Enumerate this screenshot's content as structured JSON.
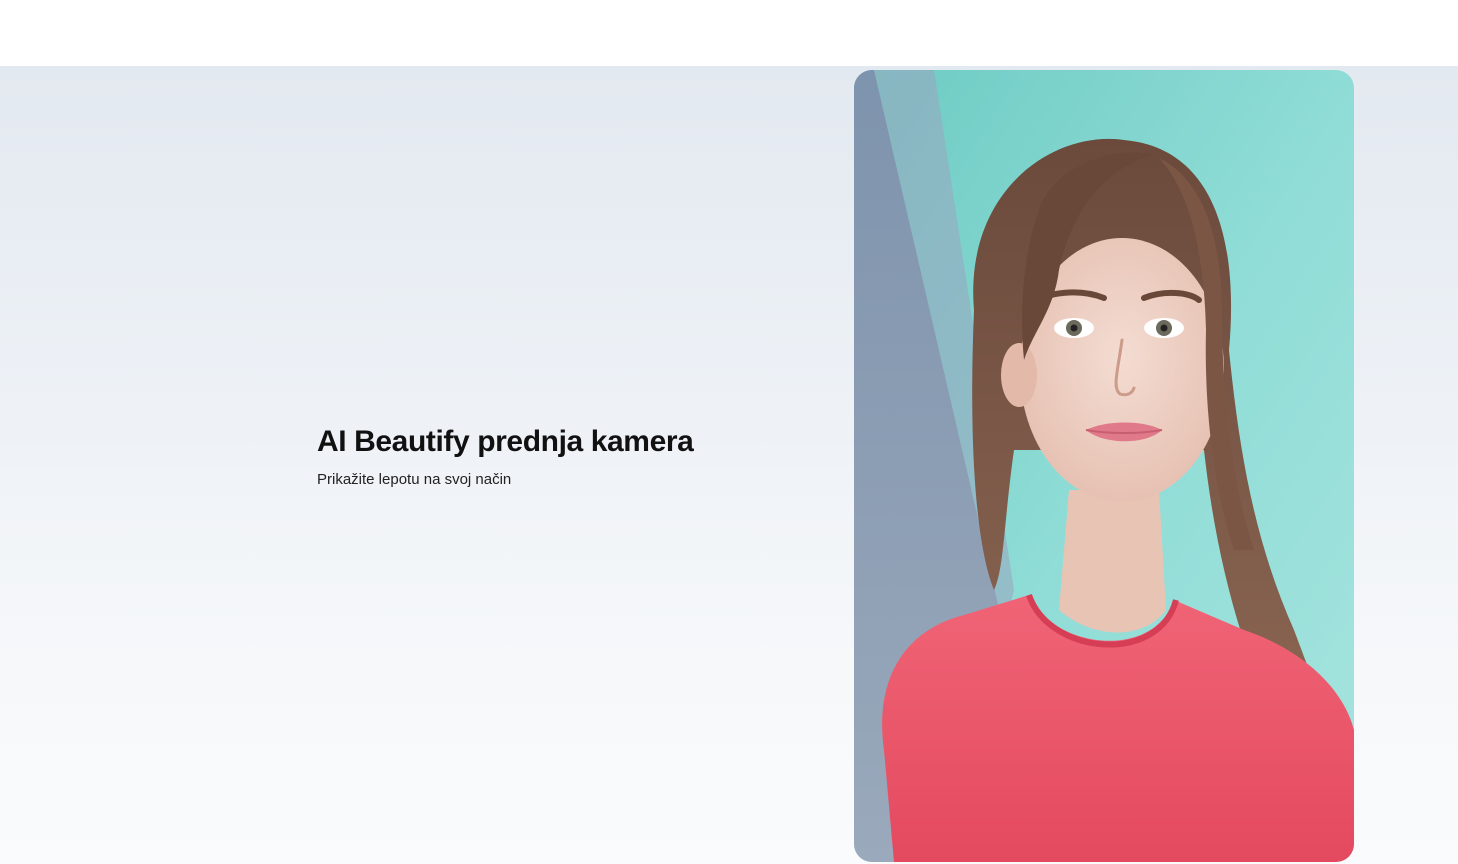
{
  "hero": {
    "title": "AI Beautify prednja kamera",
    "subtitle": "Prikažite lepotu na svoj način"
  },
  "colors": {
    "hero_bg_top": "#e3e9f0",
    "hero_bg_bottom": "#fafbfc",
    "title_text": "#111111",
    "wall_teal": "#7fd1cc",
    "wall_blue": "#8294ad",
    "shirt": "#ee5a6f",
    "hair": "#7a5544"
  }
}
